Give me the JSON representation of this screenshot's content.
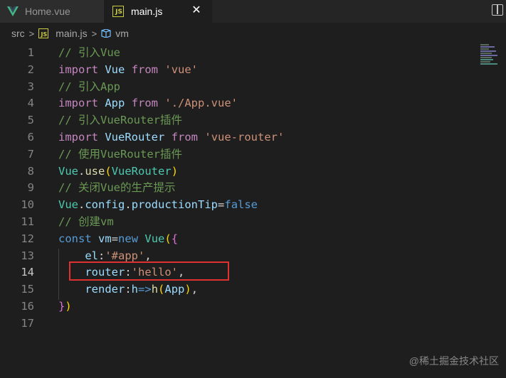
{
  "tabs": [
    {
      "label": "Home.vue",
      "icon": "vue-icon"
    },
    {
      "label": "main.js",
      "icon": "js-icon",
      "active": true
    }
  ],
  "breadcrumb": {
    "folder": "src",
    "file": "main.js",
    "symbol": "vm"
  },
  "icon_labels": {
    "js": "JS",
    "close": "✕"
  },
  "lines": [
    {
      "n": "1",
      "tokens": [
        [
          "c-com",
          "// 引入Vue"
        ]
      ]
    },
    {
      "n": "2",
      "tokens": [
        [
          "c-kw",
          "import"
        ],
        [
          "c-ws",
          " "
        ],
        [
          "c-var",
          "Vue"
        ],
        [
          "c-ws",
          " "
        ],
        [
          "c-kw",
          "from"
        ],
        [
          "c-ws",
          " "
        ],
        [
          "c-str",
          "'vue'"
        ]
      ]
    },
    {
      "n": "3",
      "tokens": [
        [
          "c-com",
          "// 引入App"
        ]
      ]
    },
    {
      "n": "4",
      "tokens": [
        [
          "c-kw",
          "import"
        ],
        [
          "c-ws",
          " "
        ],
        [
          "c-var",
          "App"
        ],
        [
          "c-ws",
          " "
        ],
        [
          "c-kw",
          "from"
        ],
        [
          "c-ws",
          " "
        ],
        [
          "c-str",
          "'./App.vue'"
        ]
      ]
    },
    {
      "n": "5",
      "tokens": [
        [
          "c-com",
          "// 引入VueRouter插件"
        ]
      ]
    },
    {
      "n": "6",
      "tokens": [
        [
          "c-kw",
          "import"
        ],
        [
          "c-ws",
          " "
        ],
        [
          "c-var",
          "VueRouter"
        ],
        [
          "c-ws",
          " "
        ],
        [
          "c-kw",
          "from"
        ],
        [
          "c-ws",
          " "
        ],
        [
          "c-str",
          "'vue-router'"
        ]
      ]
    },
    {
      "n": "7",
      "tokens": [
        [
          "c-com",
          "// 使用VueRouter插件"
        ]
      ]
    },
    {
      "n": "8",
      "tokens": [
        [
          "c-cls",
          "Vue"
        ],
        [
          "c-ws",
          "."
        ],
        [
          "c-fn",
          "use"
        ],
        [
          "c-br",
          "("
        ],
        [
          "c-cls",
          "VueRouter"
        ],
        [
          "c-br",
          ")"
        ]
      ]
    },
    {
      "n": "9",
      "tokens": [
        [
          "c-com",
          "// 关闭Vue的生产提示"
        ]
      ]
    },
    {
      "n": "10",
      "tokens": [
        [
          "c-cls",
          "Vue"
        ],
        [
          "c-ws",
          "."
        ],
        [
          "c-var",
          "config"
        ],
        [
          "c-ws",
          "."
        ],
        [
          "c-var",
          "productionTip"
        ],
        [
          "c-ws",
          "="
        ],
        [
          "c-blue",
          "false"
        ]
      ]
    },
    {
      "n": "11",
      "tokens": [
        [
          "c-com",
          "// 创建vm"
        ]
      ]
    },
    {
      "n": "12",
      "tokens": [
        [
          "c-blue",
          "const"
        ],
        [
          "c-ws",
          " "
        ],
        [
          "c-var",
          "vm"
        ],
        [
          "c-ws",
          "="
        ],
        [
          "c-blue",
          "new"
        ],
        [
          "c-ws",
          " "
        ],
        [
          "c-cls",
          "Vue"
        ],
        [
          "c-br",
          "("
        ],
        [
          "c-br2",
          "{"
        ]
      ]
    },
    {
      "n": "13",
      "tokens": [
        [
          "c-ws",
          "    "
        ],
        [
          "c-var",
          "el"
        ],
        [
          "c-ws",
          ":"
        ],
        [
          "c-str",
          "'#app'"
        ],
        [
          "c-ws",
          ","
        ]
      ]
    },
    {
      "n": "14",
      "tokens": [
        [
          "c-ws",
          "    "
        ],
        [
          "c-var",
          "router"
        ],
        [
          "c-ws",
          ":"
        ],
        [
          "c-str",
          "'hello'"
        ],
        [
          "c-ws",
          ","
        ]
      ],
      "active": true
    },
    {
      "n": "15",
      "tokens": [
        [
          "c-ws",
          "    "
        ],
        [
          "c-var",
          "render"
        ],
        [
          "c-ws",
          ":"
        ],
        [
          "c-var",
          "h"
        ],
        [
          "c-blue",
          "=>"
        ],
        [
          "c-fn",
          "h"
        ],
        [
          "c-br",
          "("
        ],
        [
          "c-var",
          "App"
        ],
        [
          "c-br",
          ")"
        ],
        [
          "c-ws",
          ","
        ]
      ]
    },
    {
      "n": "16",
      "tokens": [
        [
          "c-br2",
          "}"
        ],
        [
          "c-br",
          ")"
        ]
      ]
    },
    {
      "n": "17",
      "tokens": []
    }
  ],
  "watermark": "@稀土掘金技术社区"
}
